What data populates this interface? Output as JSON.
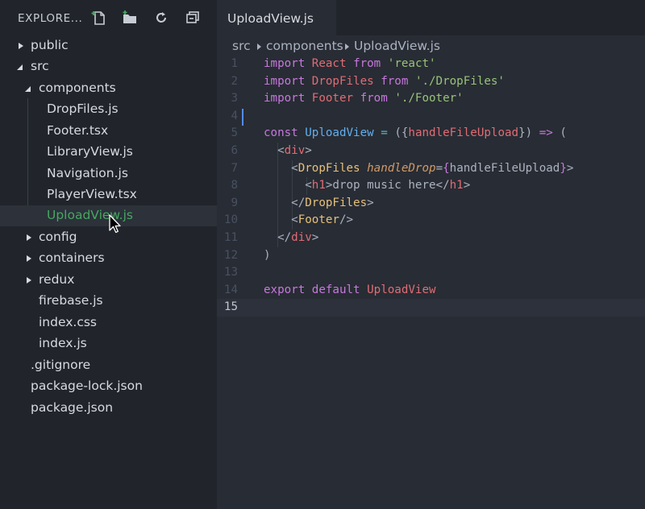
{
  "sidebar": {
    "title": "EXPLORE...",
    "header_icons": [
      "new-file-icon",
      "new-folder-icon",
      "refresh-icon",
      "collapse-all-icon"
    ],
    "tree": [
      {
        "label": "public",
        "type": "folder",
        "expanded": false
      },
      {
        "label": "src",
        "type": "folder",
        "expanded": true
      },
      {
        "label": "components",
        "type": "folder",
        "expanded": true
      },
      {
        "label": "DropFiles.js",
        "type": "file"
      },
      {
        "label": "Footer.tsx",
        "type": "file"
      },
      {
        "label": "LibraryView.js",
        "type": "file"
      },
      {
        "label": "Navigation.js",
        "type": "file"
      },
      {
        "label": "PlayerView.tsx",
        "type": "file"
      },
      {
        "label": "UploadView.js",
        "type": "file",
        "selected": true
      },
      {
        "label": "config",
        "type": "folder",
        "expanded": false
      },
      {
        "label": "containers",
        "type": "folder",
        "expanded": false
      },
      {
        "label": "redux",
        "type": "folder",
        "expanded": false
      },
      {
        "label": "firebase.js",
        "type": "file"
      },
      {
        "label": "index.css",
        "type": "file"
      },
      {
        "label": "index.js",
        "type": "file"
      },
      {
        "label": ".gitignore",
        "type": "file"
      },
      {
        "label": "package-lock.json",
        "type": "file"
      },
      {
        "label": "package.json",
        "type": "file"
      }
    ]
  },
  "editor": {
    "tab_label": "UploadView.js",
    "breadcrumb": [
      "src",
      "components",
      "UploadView.js"
    ],
    "current_line": 15,
    "lines": [
      {
        "num": "1",
        "tokens": [
          [
            "kw",
            "import"
          ],
          [
            "pl",
            " "
          ],
          [
            "var",
            "React"
          ],
          [
            "pl",
            " "
          ],
          [
            "kw",
            "from"
          ],
          [
            "pl",
            " "
          ],
          [
            "str",
            "'react'"
          ]
        ]
      },
      {
        "num": "2",
        "tokens": [
          [
            "kw",
            "import"
          ],
          [
            "pl",
            " "
          ],
          [
            "var",
            "DropFiles"
          ],
          [
            "pl",
            " "
          ],
          [
            "kw",
            "from"
          ],
          [
            "pl",
            " "
          ],
          [
            "str",
            "'./DropFiles'"
          ]
        ]
      },
      {
        "num": "3",
        "tokens": [
          [
            "kw",
            "import"
          ],
          [
            "pl",
            " "
          ],
          [
            "var",
            "Footer"
          ],
          [
            "pl",
            " "
          ],
          [
            "kw",
            "from"
          ],
          [
            "pl",
            " "
          ],
          [
            "str",
            "'./Footer'"
          ]
        ]
      },
      {
        "num": "4",
        "tokens": []
      },
      {
        "num": "5",
        "tokens": [
          [
            "kw",
            "const"
          ],
          [
            "pl",
            " "
          ],
          [
            "fn",
            "UploadView"
          ],
          [
            "pl",
            " "
          ],
          [
            "op",
            "="
          ],
          [
            "pl",
            " ({"
          ],
          [
            "var",
            "handleFileUpload"
          ],
          [
            "pl",
            "}) "
          ],
          [
            "kw",
            "=>"
          ],
          [
            "pl",
            " ("
          ]
        ]
      },
      {
        "num": "6",
        "tokens": [
          [
            "pl",
            "  <"
          ],
          [
            "tag",
            "div"
          ],
          [
            "pl",
            ">"
          ]
        ]
      },
      {
        "num": "7",
        "tokens": [
          [
            "pl",
            "    <"
          ],
          [
            "comp",
            "DropFiles"
          ],
          [
            "pl",
            " "
          ],
          [
            "attr",
            "handleDrop"
          ],
          [
            "pl",
            "="
          ],
          [
            "kw",
            "{"
          ],
          [
            "pl",
            "handleFileUpload"
          ],
          [
            "kw",
            "}"
          ],
          [
            "pl",
            ">"
          ]
        ]
      },
      {
        "num": "8",
        "tokens": [
          [
            "pl",
            "      <"
          ],
          [
            "tag",
            "h1"
          ],
          [
            "pl",
            ">drop music here</"
          ],
          [
            "tag",
            "h1"
          ],
          [
            "pl",
            ">"
          ]
        ]
      },
      {
        "num": "9",
        "tokens": [
          [
            "pl",
            "    </"
          ],
          [
            "comp",
            "DropFiles"
          ],
          [
            "pl",
            ">"
          ]
        ]
      },
      {
        "num": "10",
        "tokens": [
          [
            "pl",
            "    <"
          ],
          [
            "comp",
            "Footer"
          ],
          [
            "pl",
            "/>"
          ]
        ]
      },
      {
        "num": "11",
        "tokens": [
          [
            "pl",
            "  </"
          ],
          [
            "tag",
            "div"
          ],
          [
            "pl",
            ">"
          ]
        ]
      },
      {
        "num": "12",
        "tokens": [
          [
            "pl",
            ")"
          ]
        ]
      },
      {
        "num": "13",
        "tokens": []
      },
      {
        "num": "14",
        "tokens": [
          [
            "kw",
            "export"
          ],
          [
            "pl",
            " "
          ],
          [
            "kw",
            "default"
          ],
          [
            "pl",
            " "
          ],
          [
            "var",
            "UploadView"
          ]
        ]
      },
      {
        "num": "15",
        "tokens": []
      }
    ]
  },
  "colors": {
    "selected_file": "#45a85f",
    "caret": "#528bff",
    "keyword": "#c678dd",
    "variable": "#e06c75",
    "string": "#98c379"
  }
}
